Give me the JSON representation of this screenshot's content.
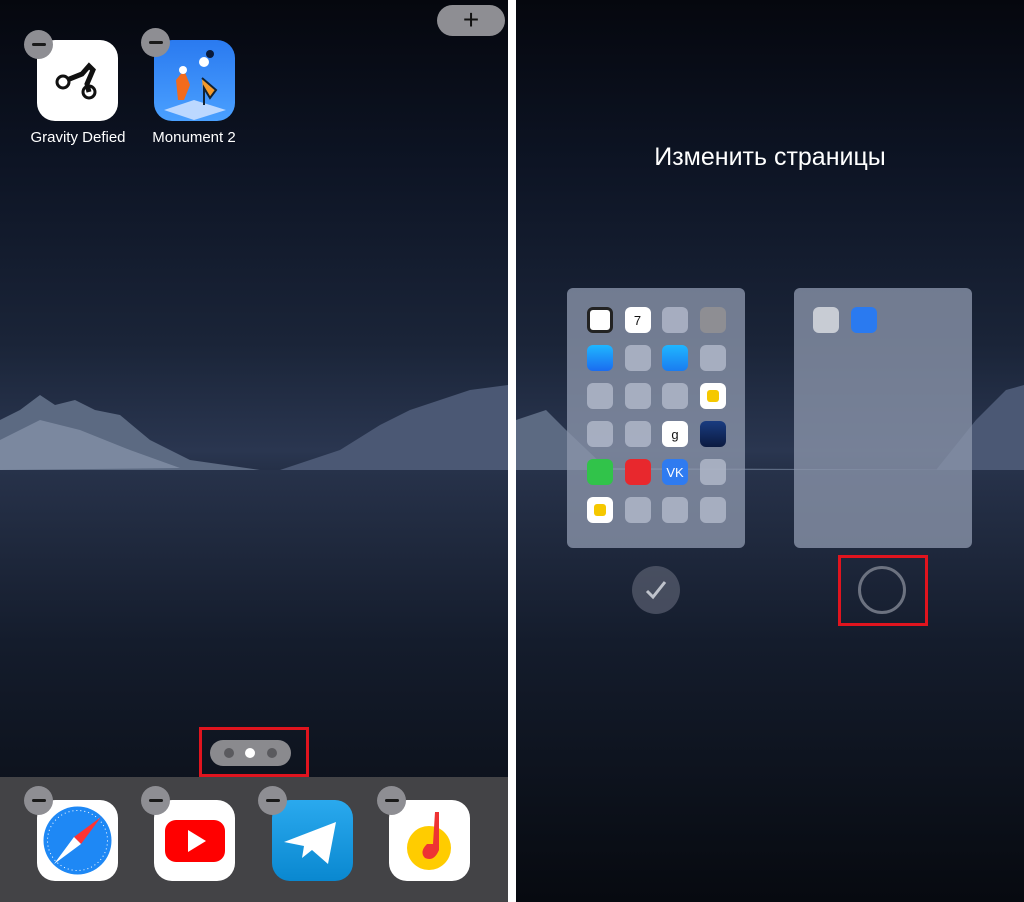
{
  "left_screen": {
    "add_widget_button": "+",
    "apps": [
      {
        "label": "Gravity Defied",
        "icon": "gravity-defied-icon"
      },
      {
        "label": "Monument 2",
        "icon": "monument-valley-2-icon"
      }
    ],
    "page_indicator": {
      "pages": 3,
      "current": 2
    },
    "dock": [
      {
        "icon": "safari-icon"
      },
      {
        "icon": "youtube-icon"
      },
      {
        "icon": "telegram-icon"
      },
      {
        "icon": "yandex-music-icon"
      }
    ]
  },
  "right_screen": {
    "title": "Изменить страницы",
    "pages": [
      {
        "visible": true,
        "icons": [
          "clock",
          "calendar",
          "folder",
          "settings",
          "app-store",
          "folder",
          "mail",
          "folder",
          "folder",
          "folder",
          "folder",
          "wallet",
          "folder",
          "folder",
          "genius",
          "steam",
          "messages",
          "yandex",
          "vk",
          "folder",
          "keychain",
          "folder",
          "folder",
          "folder"
        ]
      },
      {
        "visible": false,
        "icons": [
          "gravity-defied",
          "monument-valley-2"
        ]
      }
    ],
    "calendar_day": "7"
  },
  "colors": {
    "highlight": "#e0141e",
    "badge": "#8e8e93",
    "dock": "#434346"
  }
}
